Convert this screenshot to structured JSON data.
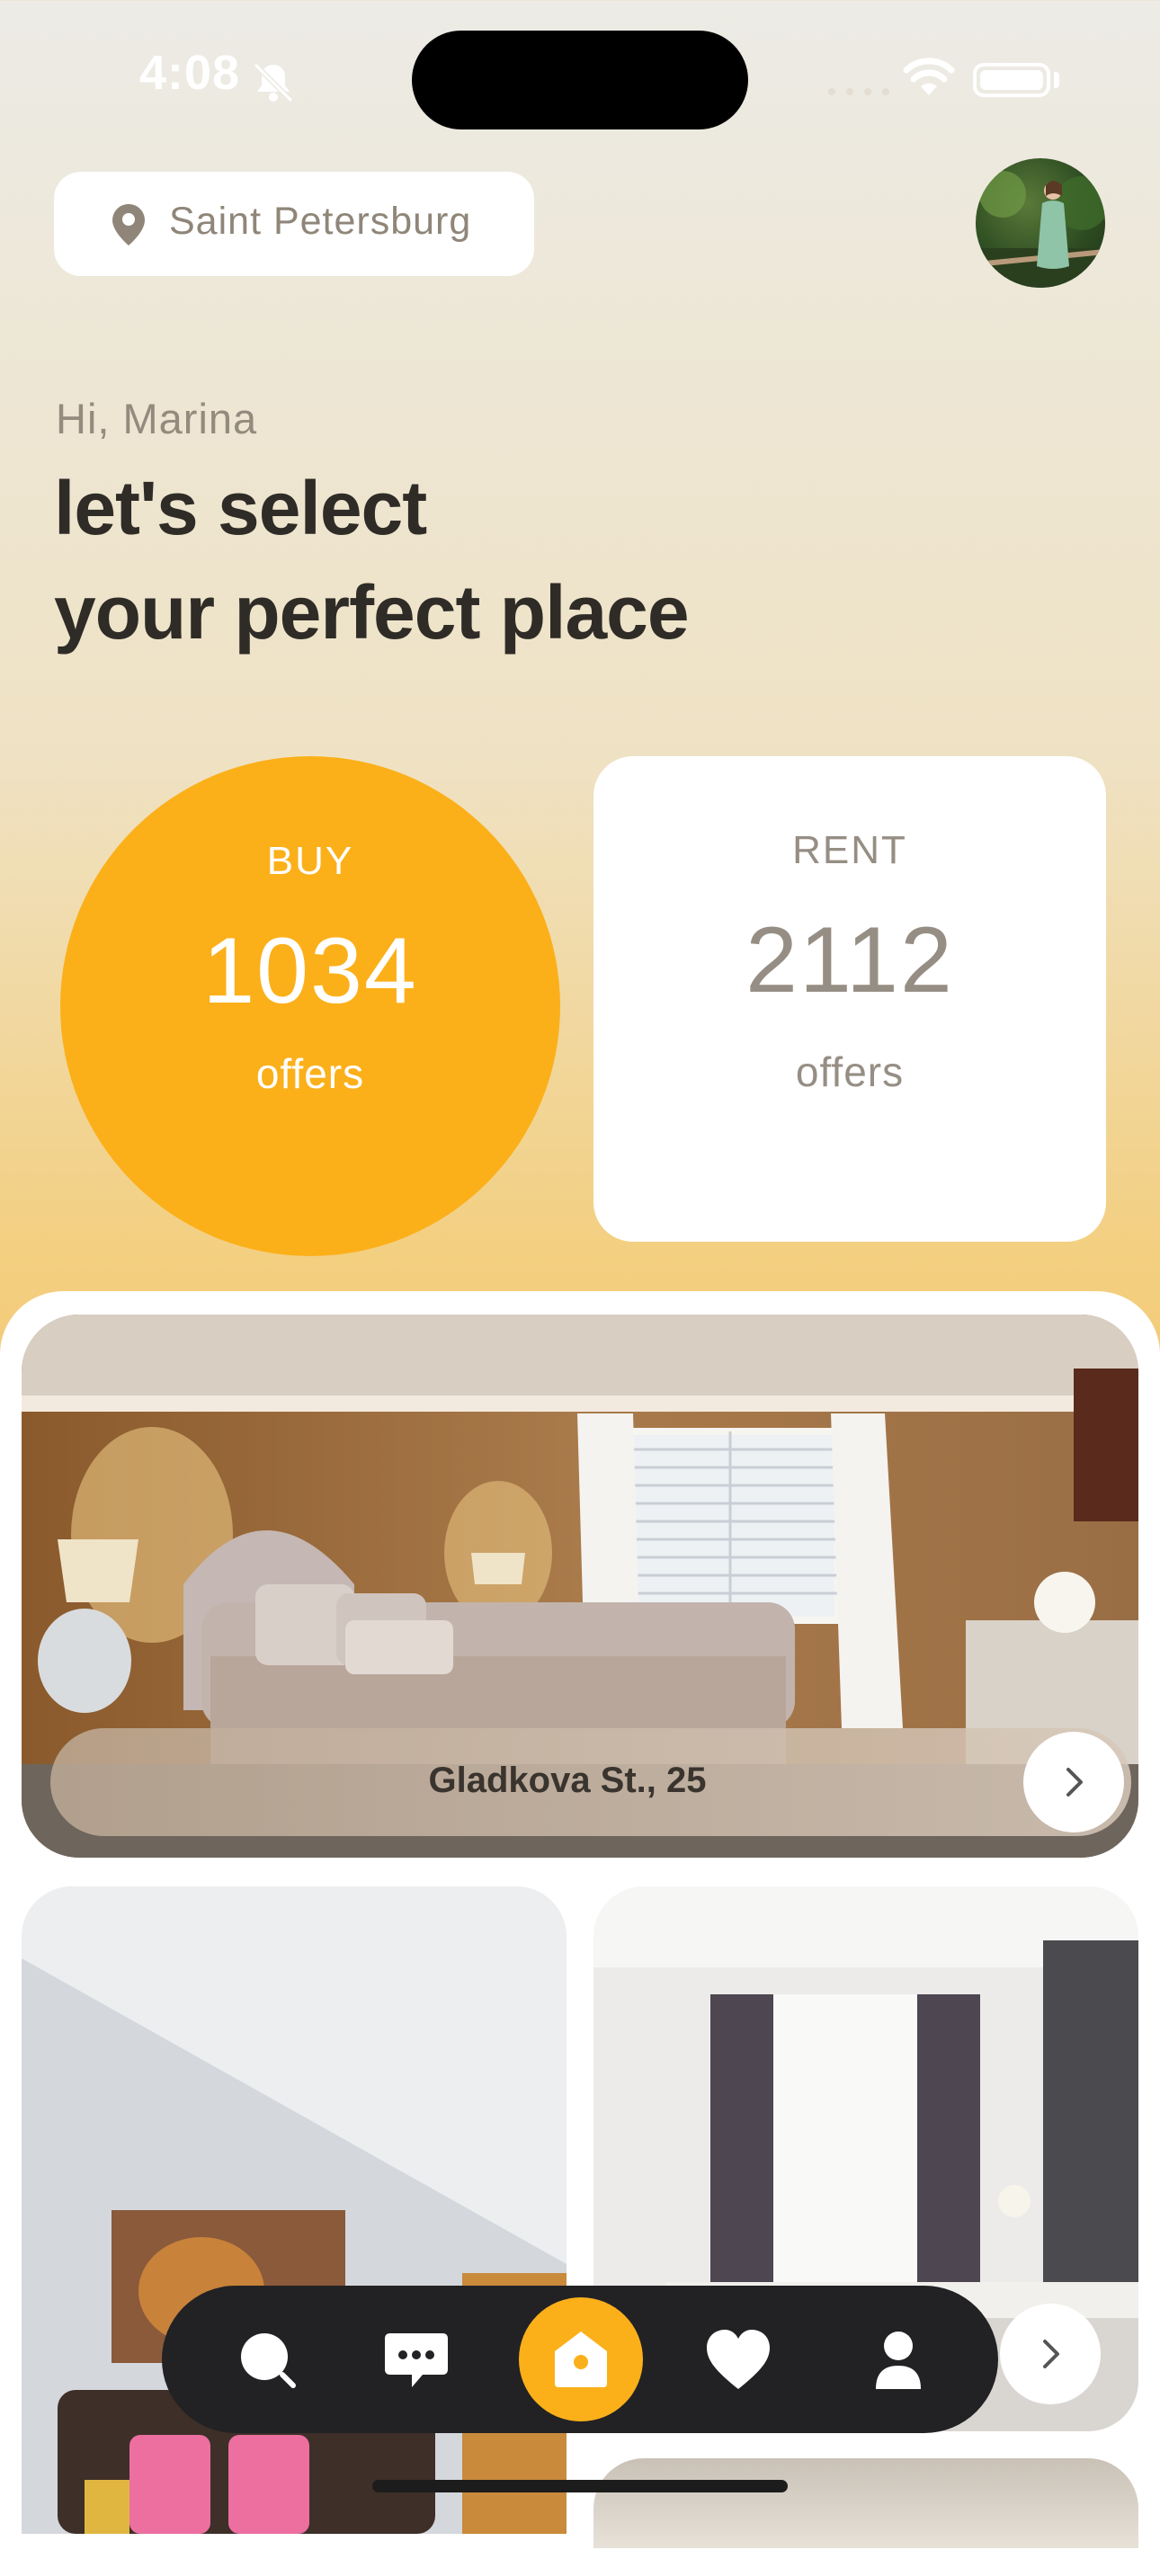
{
  "status_bar": {
    "time": "4:08"
  },
  "location": {
    "city": "Saint Petersburg"
  },
  "greeting": {
    "hello": "Hi, Marina",
    "headline_line1": "let's select",
    "headline_line2": "your perfect place"
  },
  "buy": {
    "label": "BUY",
    "count": "1034",
    "unit": "offers"
  },
  "rent": {
    "label": "RENT",
    "count": "2112",
    "unit": "offers"
  },
  "listings": [
    {
      "address": "Gladkova St., 25"
    }
  ],
  "colors": {
    "accent": "#fbb01a",
    "dark": "#222225",
    "text": "#2f2b27",
    "muted": "#948b7e"
  },
  "tabbar": {
    "items": [
      "search-icon",
      "chat-icon",
      "home-icon",
      "heart-icon",
      "profile-icon"
    ],
    "active": "home-icon"
  }
}
